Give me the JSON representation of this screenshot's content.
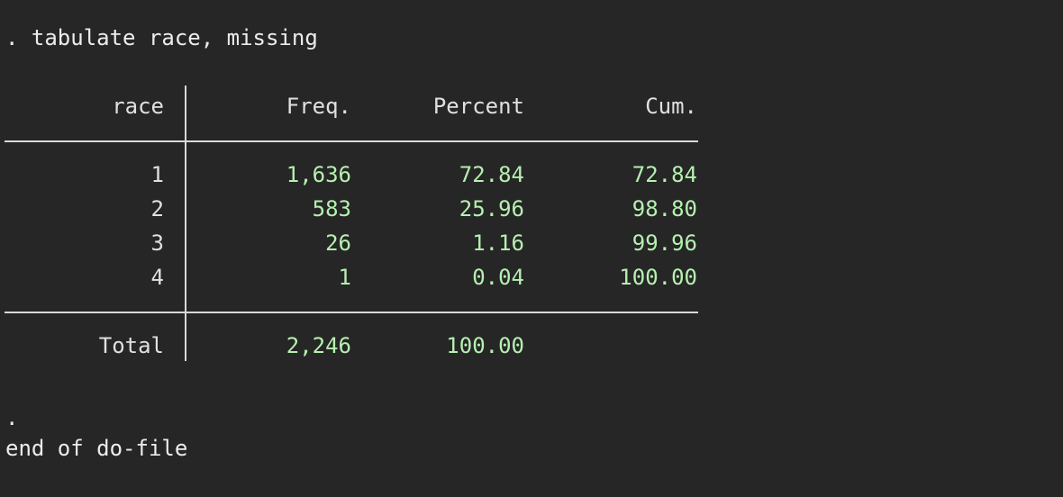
{
  "console": {
    "command_line": ". tabulate race, missing",
    "prompt_dot": ".",
    "end_message": "end of do-file"
  },
  "table": {
    "headers": {
      "var": "race",
      "freq": "Freq.",
      "percent": "Percent",
      "cum": "Cum."
    },
    "rows": [
      {
        "label": "1",
        "freq": "1,636",
        "percent": "72.84",
        "cum": "72.84"
      },
      {
        "label": "2",
        "freq": "583",
        "percent": "25.96",
        "cum": "98.80"
      },
      {
        "label": "3",
        "freq": "26",
        "percent": "1.16",
        "cum": "99.96"
      },
      {
        "label": "4",
        "freq": "1",
        "percent": "0.04",
        "cum": "100.00"
      }
    ],
    "total": {
      "label": "Total",
      "freq": "2,246",
      "percent": "100.00"
    }
  },
  "colors": {
    "background": "#262626",
    "text": "#e8e8e8",
    "result": "#b6f0b0",
    "rule": "#d8d8d8"
  }
}
